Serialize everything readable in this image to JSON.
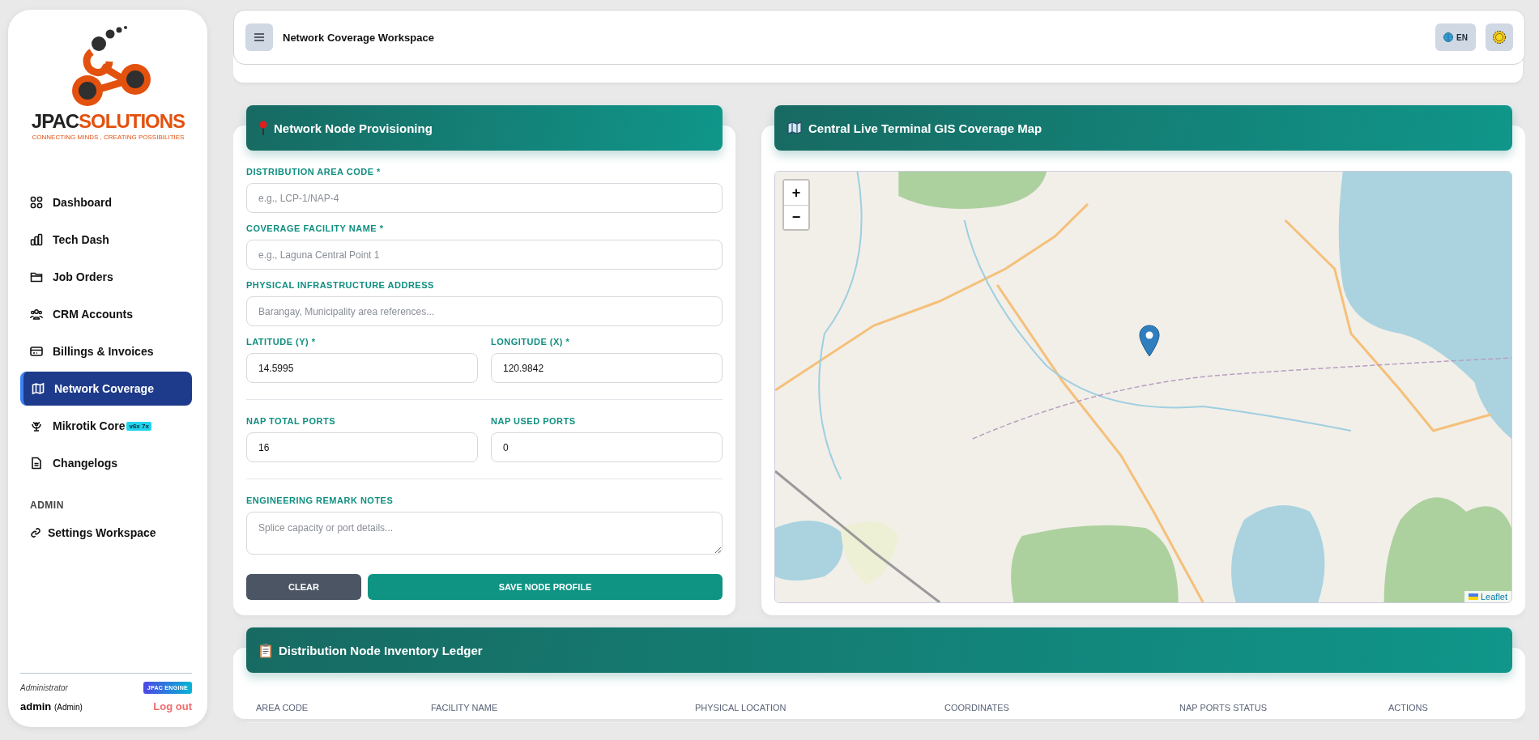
{
  "sidebar": {
    "logo": {
      "brand_dark": "JPAC",
      "brand_accent": "SOLUTIONS",
      "tagline": "CONNECTING MINDS , CREATING POSSIBILITIES"
    },
    "items": [
      {
        "label": "Dashboard",
        "selected": false
      },
      {
        "label": "Tech Dash",
        "selected": false
      },
      {
        "label": "Job Orders",
        "selected": false
      },
      {
        "label": "CRM Accounts",
        "selected": false
      },
      {
        "label": "Billings & Invoices",
        "selected": false
      },
      {
        "label": "Network Coverage",
        "selected": true
      },
      {
        "label": "Mikrotik Core",
        "badge": "v6x 7x",
        "selected": false
      },
      {
        "label": "Changelogs",
        "selected": false
      }
    ],
    "section_title": "ADMIN",
    "admin_items": [
      {
        "label": "Settings Workspace",
        "selected": false
      }
    ],
    "footer": {
      "role": "Administrator",
      "badge": "JPAC ENGINE",
      "user": "admin",
      "user_role": "(Admin)",
      "logout": "Log out"
    }
  },
  "topbar": {
    "title": "Network Coverage Workspace",
    "language": "EN"
  },
  "form": {
    "title": "Network Node Provisioning",
    "rows": [
      {
        "divider": false,
        "fields": [
          {
            "kind": "text",
            "label": "DISTRIBUTION AREA CODE *",
            "placeholder": "e.g., LCP-1/NAP-4"
          }
        ]
      },
      {
        "divider": false,
        "fields": [
          {
            "kind": "text",
            "label": "COVERAGE FACILITY NAME *",
            "placeholder": "e.g., Laguna Central Point 1"
          }
        ]
      },
      {
        "divider": false,
        "fields": [
          {
            "kind": "text",
            "label": "PHYSICAL INFRASTRUCTURE ADDRESS",
            "placeholder": "Barangay, Municipality area references..."
          }
        ]
      },
      {
        "divider": false,
        "fields": [
          {
            "kind": "text",
            "label": "LATITUDE (Y) *",
            "value": "14.5995"
          },
          {
            "kind": "text",
            "label": "LONGITUDE (X) *",
            "value": "120.9842"
          }
        ]
      },
      {
        "divider": true,
        "fields": [
          {
            "kind": "text",
            "label": "NAP TOTAL PORTS",
            "value": "16"
          },
          {
            "kind": "text",
            "label": "NAP USED PORTS",
            "value": "0"
          }
        ]
      },
      {
        "divider": true,
        "fields": [
          {
            "kind": "textarea",
            "label": "ENGINEERING REMARK NOTES",
            "placeholder": "Splice capacity or port details..."
          }
        ]
      }
    ],
    "buttons": [
      {
        "kind": "secondary",
        "label": "CLEAR"
      },
      {
        "kind": "primary",
        "label": "SAVE NODE PROFILE"
      }
    ]
  },
  "map": {
    "title": "Central Live Terminal GIS Coverage Map",
    "zoom_in": "+",
    "zoom_out": "−",
    "attribution": "Leaflet"
  },
  "ledger": {
    "title": "Distribution Node Inventory Ledger",
    "columns": [
      "AREA CODE",
      "FACILITY NAME",
      "PHYSICAL LOCATION",
      "COORDINATES",
      "NAP PORTS STATUS",
      "ACTIONS"
    ]
  }
}
